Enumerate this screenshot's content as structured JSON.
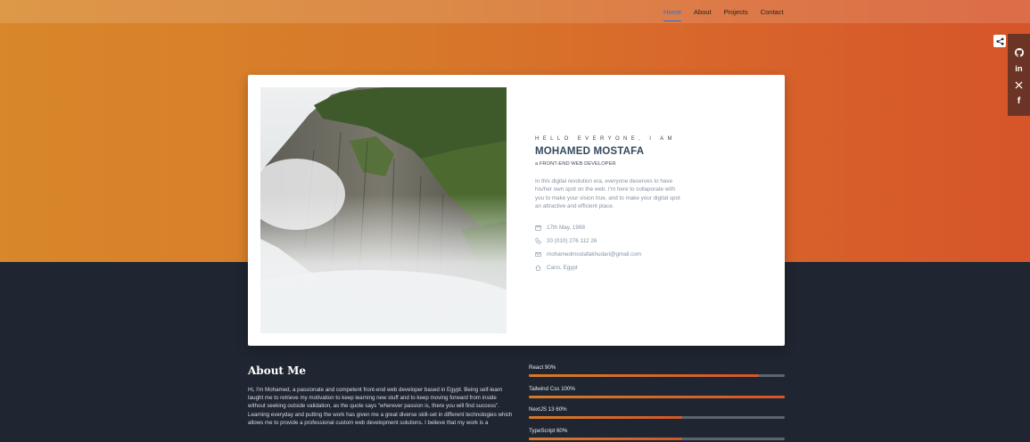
{
  "nav": {
    "items": [
      {
        "label": "Home",
        "active": true
      },
      {
        "label": "About",
        "active": false
      },
      {
        "label": "Projects",
        "active": false
      },
      {
        "label": "Contact",
        "active": false
      }
    ]
  },
  "social": {
    "share_icon": "share-icon",
    "items": [
      {
        "icon": "github-icon",
        "glyph": "◯"
      },
      {
        "icon": "linkedin-icon",
        "glyph": "in"
      },
      {
        "icon": "x-icon",
        "glyph": "𝕏"
      },
      {
        "icon": "facebook-icon",
        "glyph": "f"
      }
    ]
  },
  "hero": {
    "greeting": "HELLO EVERYONE, I AM",
    "name": "MOHAMED MOSTAFA",
    "role": "a FRONT-END WEB DEVELOPER",
    "bio": "In this digital revolution era, everyone deserves to have his/her own spot on the web. I'm here to collaporate with you to make your vision true, and to make your digital spot an attractive and efficient place.",
    "info": {
      "birthday": "17th May, 1998",
      "phone": "20 (010) 276 112 26",
      "email": "mohamedmostafakhudari@gmail.com",
      "location": "Cairo, Egypt"
    }
  },
  "about": {
    "title": "About Me",
    "text": "Hi, I'm Mohamed, a passionate and competent front-end web developer based in Egypt. Being self-learn taught me to retrieve my motivation to keep learning new stuff and to keep moving forward from inside without seeking outside validation, as the quote says \"wherever passion is, there you will find success\". Learning everyday and putting the work has given me a great diverse skill-set in different technologies which allows me to provide a professional custom web development solutions. I believe that my work is a"
  },
  "skills": [
    {
      "label": "React 90%",
      "level": 0.9
    },
    {
      "label": "Tailwind Css 100%",
      "level": 1.0
    },
    {
      "label": "NextJS 13 60%",
      "level": 0.6
    },
    {
      "label": "TypeScript 60%",
      "level": 0.6
    }
  ],
  "colors": {
    "accent_orange": "#d8872a",
    "accent_red": "#d6552a",
    "dark_bg": "#1f2631",
    "nav_active": "#2a6fd6"
  }
}
